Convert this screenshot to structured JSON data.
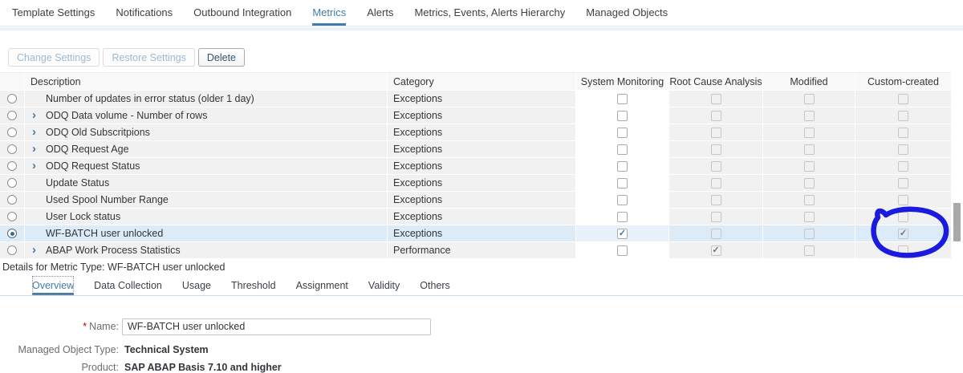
{
  "top_tabs": {
    "items": [
      {
        "label": "Template Settings",
        "active": false
      },
      {
        "label": "Notifications",
        "active": false
      },
      {
        "label": "Outbound Integration",
        "active": false
      },
      {
        "label": "Metrics",
        "active": true
      },
      {
        "label": "Alerts",
        "active": false
      },
      {
        "label": "Metrics, Events, Alerts Hierarchy",
        "active": false
      },
      {
        "label": "Managed Objects",
        "active": false
      }
    ]
  },
  "toolbar": {
    "buttons": [
      {
        "label": "Change Settings",
        "enabled": false
      },
      {
        "label": "Restore Settings",
        "enabled": false
      },
      {
        "label": "Delete",
        "enabled": true
      }
    ]
  },
  "table": {
    "columns": {
      "description": "Description",
      "category": "Category",
      "system_monitoring": "System Monitoring",
      "root_cause_analysis": "Root Cause Analysis",
      "modified": "Modified",
      "custom_created": "Custom-created"
    },
    "rows": [
      {
        "description": "Number of updates in error status (older 1 day)",
        "expandable": false,
        "category": "Exceptions",
        "system_monitoring": false,
        "root_cause_analysis": false,
        "modified": false,
        "custom_created": false,
        "selected": false
      },
      {
        "description": "ODQ Data volume - Number of rows",
        "expandable": true,
        "category": "Exceptions",
        "system_monitoring": false,
        "root_cause_analysis": false,
        "modified": false,
        "custom_created": false,
        "selected": false
      },
      {
        "description": "ODQ Old Subscritpions",
        "expandable": true,
        "category": "Exceptions",
        "system_monitoring": false,
        "root_cause_analysis": false,
        "modified": false,
        "custom_created": false,
        "selected": false
      },
      {
        "description": "ODQ Request Age",
        "expandable": true,
        "category": "Exceptions",
        "system_monitoring": false,
        "root_cause_analysis": false,
        "modified": false,
        "custom_created": false,
        "selected": false
      },
      {
        "description": "ODQ Request Status",
        "expandable": true,
        "category": "Exceptions",
        "system_monitoring": false,
        "root_cause_analysis": false,
        "modified": false,
        "custom_created": false,
        "selected": false
      },
      {
        "description": "Update Status",
        "expandable": false,
        "category": "Exceptions",
        "system_monitoring": false,
        "root_cause_analysis": false,
        "modified": false,
        "custom_created": false,
        "selected": false
      },
      {
        "description": "Used Spool Number Range",
        "expandable": false,
        "category": "Exceptions",
        "system_monitoring": false,
        "root_cause_analysis": false,
        "modified": false,
        "custom_created": false,
        "selected": false
      },
      {
        "description": "User Lock status",
        "expandable": false,
        "category": "Exceptions",
        "system_monitoring": false,
        "root_cause_analysis": false,
        "modified": false,
        "custom_created": false,
        "selected": false
      },
      {
        "description": "WF-BATCH user unlocked",
        "expandable": false,
        "category": "Exceptions",
        "system_monitoring": true,
        "root_cause_analysis": false,
        "modified": false,
        "custom_created": true,
        "selected": true
      },
      {
        "description": "ABAP Work Process Statistics",
        "expandable": true,
        "category": "Performance",
        "system_monitoring": false,
        "root_cause_analysis": true,
        "modified": false,
        "custom_created": false,
        "selected": false
      }
    ]
  },
  "details": {
    "title": "Details for Metric Type: WF-BATCH user unlocked",
    "tabs": [
      {
        "label": "Overview",
        "active": true
      },
      {
        "label": "Data Collection",
        "active": false
      },
      {
        "label": "Usage",
        "active": false
      },
      {
        "label": "Threshold",
        "active": false
      },
      {
        "label": "Assignment",
        "active": false
      },
      {
        "label": "Validity",
        "active": false
      },
      {
        "label": "Others",
        "active": false
      }
    ],
    "form": {
      "required_marker": "*",
      "name_label": "Name:",
      "name_value": "WF-BATCH user unlocked",
      "managed_object_type_label": "Managed Object Type:",
      "managed_object_type_value": "Technical System",
      "product_label": "Product:",
      "product_value": "SAP ABAP Basis 7.10 and higher"
    }
  },
  "annotation": {
    "shape": "hand-drawn-circle around Custom-created checkbox of selected row",
    "color": "#1b1be0"
  },
  "colors": {
    "accent_blue": "#427cac",
    "row_background": "#f1f1f1",
    "selected_row_background": "#dcebf8",
    "disabled_button_text": "#9eb8ce",
    "required_red": "#b00000"
  }
}
